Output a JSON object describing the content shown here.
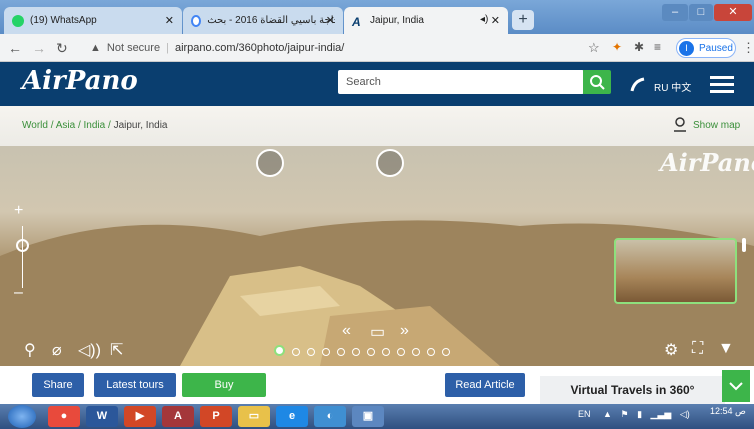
{
  "tabs": [
    {
      "label": "(19) WhatsApp",
      "icon": "whatsapp-icon",
      "color": "#25d366"
    },
    {
      "label": "مقياس حاجة باسيي القضاة 2016 - بحث",
      "icon": "google-icon",
      "color": "#4285f4"
    },
    {
      "label": "Jaipur, India",
      "icon": "airpano-icon",
      "color": "#0a3e6f"
    }
  ],
  "address": {
    "security": "Not secure",
    "url": "airpano.com/360photo/jaipur-india/",
    "profile_status": "Paused",
    "profile_initial": "I"
  },
  "site": {
    "logo": "AirPano",
    "search_placeholder": "Search",
    "langs": "RU 中文"
  },
  "breadcrumb": {
    "parts": [
      "World",
      "Asia",
      "India"
    ],
    "current": "Jaipur, India",
    "show_map": "Show map"
  },
  "pano": {
    "watermark": "AirPano"
  },
  "bottom": {
    "share": "Share",
    "latest": "Latest tours",
    "buy": "Buy",
    "read": "Read Article",
    "virtual": "Virtual Travels in 360°"
  },
  "taskbar": {
    "lang": "EN",
    "time": "12:54 ص"
  },
  "colors": {
    "header": "#0a3e6f",
    "accent_green": "#3db54a",
    "button_blue": "#2d5fa8"
  }
}
